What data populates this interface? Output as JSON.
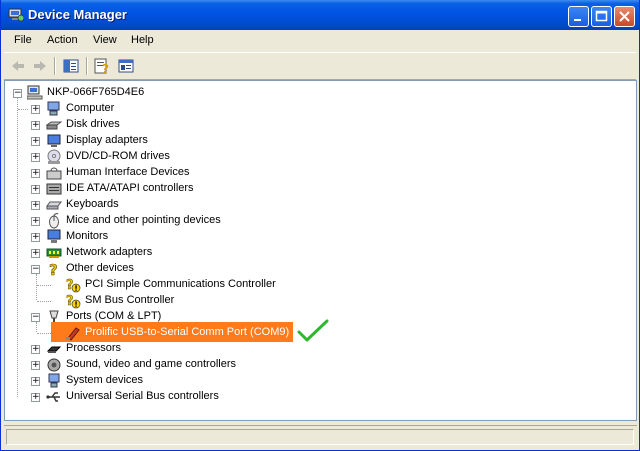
{
  "window": {
    "title": "Device Manager"
  },
  "menubar": {
    "items": [
      {
        "label": "File"
      },
      {
        "label": "Action"
      },
      {
        "label": "View"
      },
      {
        "label": "Help"
      }
    ]
  },
  "toolbar": {
    "buttons": [
      "back-icon",
      "forward-icon",
      "show-hide-tree-icon",
      "properties-icon",
      "update-driver-icon"
    ]
  },
  "tree": {
    "root": {
      "label": "NKP-066F765D4E6",
      "expanded": true,
      "icon": "computer-icon"
    },
    "categories": [
      {
        "label": "Computer",
        "expanded": false,
        "icon": "computer-icon"
      },
      {
        "label": "Disk drives",
        "expanded": false,
        "icon": "disk-drive-icon"
      },
      {
        "label": "Display adapters",
        "expanded": false,
        "icon": "display-adapter-icon"
      },
      {
        "label": "DVD/CD-ROM drives",
        "expanded": false,
        "icon": "dvd-icon"
      },
      {
        "label": "Human Interface Devices",
        "expanded": false,
        "icon": "hid-icon"
      },
      {
        "label": "IDE ATA/ATAPI controllers",
        "expanded": false,
        "icon": "ide-icon"
      },
      {
        "label": "Keyboards",
        "expanded": false,
        "icon": "keyboard-icon"
      },
      {
        "label": "Mice and other pointing devices",
        "expanded": false,
        "icon": "mouse-icon"
      },
      {
        "label": "Monitors",
        "expanded": false,
        "icon": "monitor-icon"
      },
      {
        "label": "Network adapters",
        "expanded": false,
        "icon": "network-adapter-icon"
      },
      {
        "label": "Other devices",
        "expanded": true,
        "icon": "unknown-device-icon",
        "children": [
          {
            "label": "PCI Simple Communications Controller",
            "icon": "warning-device-icon"
          },
          {
            "label": "SM Bus Controller",
            "icon": "warning-device-icon"
          }
        ]
      },
      {
        "label": "Ports (COM & LPT)",
        "expanded": true,
        "icon": "port-icon",
        "children": [
          {
            "label": "Prolific USB-to-Serial Comm Port (COM9)",
            "icon": "serial-port-icon",
            "highlighted": true,
            "highlight_color": "#ff7a1a",
            "annotation": "green-checkmark",
            "annotation_color": "#2eb82e"
          }
        ]
      },
      {
        "label": "Processors",
        "expanded": false,
        "icon": "processor-icon"
      },
      {
        "label": "Sound, video and game controllers",
        "expanded": false,
        "icon": "sound-icon"
      },
      {
        "label": "System devices",
        "expanded": false,
        "icon": "system-devices-icon"
      },
      {
        "label": "Universal Serial Bus controllers",
        "expanded": false,
        "icon": "usb-icon"
      }
    ]
  },
  "colors": {
    "titlebar": "#0054e3",
    "highlight": "#ff7a1a",
    "checkmark": "#2eb82e"
  }
}
